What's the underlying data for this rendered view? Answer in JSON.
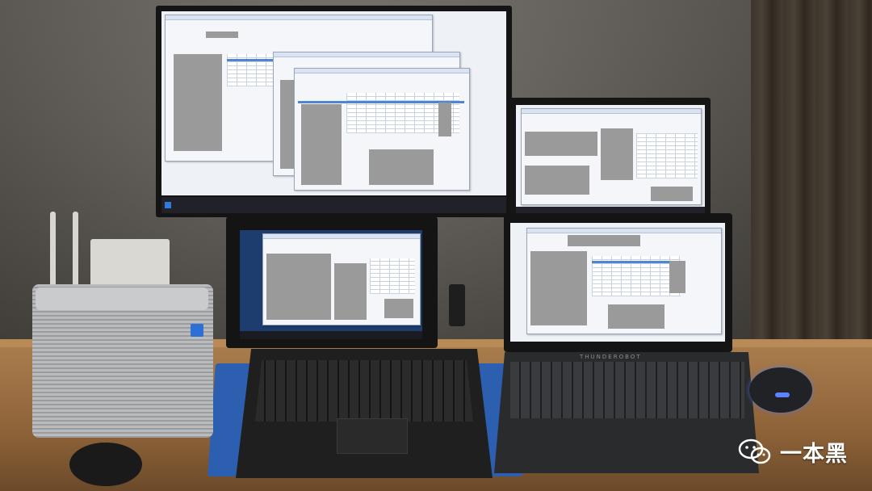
{
  "scene": {
    "description_tags": [
      "multi-monitor",
      "laptops",
      "router",
      "mini-pc",
      "mouse",
      "desk"
    ]
  },
  "monitor": {
    "taskbar_items": [
      "",
      "",
      ""
    ]
  },
  "laptop_right": {
    "brand": "THUNDEROBOT"
  },
  "watermark": {
    "text": "一本黑",
    "icon": "wechat-icon"
  },
  "colors": {
    "mat": "#2d5fb0",
    "mouse_glow": "#5c82ff",
    "screen_bg": "#eef1f6"
  }
}
